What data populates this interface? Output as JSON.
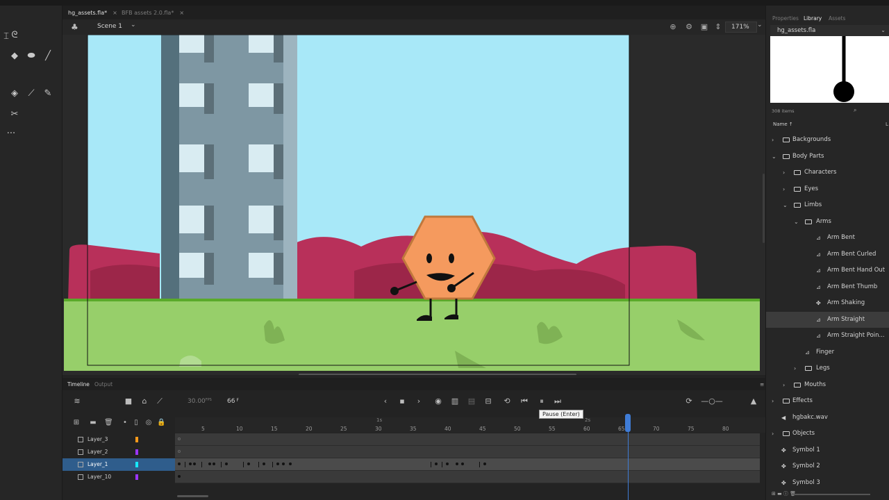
{
  "tabs": [
    {
      "label": "hg_assets.fla*",
      "active": true
    },
    {
      "label": "BFB assets 2.0.fla*",
      "active": false
    }
  ],
  "scene": {
    "label": "Scene 1",
    "zoom": "171%"
  },
  "timeline": {
    "tabs": [
      "Timeline",
      "Output"
    ],
    "fps": "30.00",
    "fps_unit": "FPS",
    "frame": "66",
    "frame_unit": "F",
    "tooltip": "Pause (Enter)",
    "seconds_markers": [
      "1s",
      "2s"
    ],
    "ruler_ticks": [
      "5",
      "10",
      "15",
      "20",
      "25",
      "30",
      "35",
      "40",
      "45",
      "50",
      "55",
      "60",
      "65",
      "70",
      "75",
      "80"
    ],
    "layers": [
      {
        "name": "Layer_3",
        "color": "#ff9a1a",
        "active": false
      },
      {
        "name": "Layer_2",
        "color": "#9b35ff",
        "active": false
      },
      {
        "name": "Layer_1",
        "color": "#17e8ff",
        "active": true
      },
      {
        "name": "Layer_10",
        "color": "#9b35ff",
        "active": false
      }
    ]
  },
  "library": {
    "tabs": [
      "Properties",
      "Library",
      "Assets"
    ],
    "active_tab": "Library",
    "document": "hg_assets.fla",
    "items_count": "308 items",
    "name_column": "Name",
    "tree": [
      {
        "label": "Backgrounds",
        "type": "folder",
        "depth": 0,
        "expanded": false
      },
      {
        "label": "Body Parts",
        "type": "folder",
        "depth": 0,
        "expanded": true
      },
      {
        "label": "Characters",
        "type": "folder",
        "depth": 1,
        "expanded": false
      },
      {
        "label": "Eyes",
        "type": "folder",
        "depth": 1,
        "expanded": false
      },
      {
        "label": "Limbs",
        "type": "folder",
        "depth": 1,
        "expanded": true
      },
      {
        "label": "Arms",
        "type": "folder",
        "depth": 2,
        "expanded": true
      },
      {
        "label": "Arm Bent",
        "type": "graphic",
        "depth": 3
      },
      {
        "label": "Arm Bent Curled",
        "type": "graphic",
        "depth": 3
      },
      {
        "label": "Arm Bent Hand Out",
        "type": "graphic",
        "depth": 3
      },
      {
        "label": "Arm Bent Thumb",
        "type": "graphic",
        "depth": 3
      },
      {
        "label": "Arm Shaking",
        "type": "symbol",
        "depth": 3
      },
      {
        "label": "Arm Straight",
        "type": "graphic",
        "depth": 3,
        "selected": true
      },
      {
        "label": "Arm Straight Poin...",
        "type": "graphic",
        "depth": 3
      },
      {
        "label": "Finger",
        "type": "graphic",
        "depth": 2
      },
      {
        "label": "Legs",
        "type": "folder",
        "depth": 2,
        "expanded": false
      },
      {
        "label": "Mouths",
        "type": "folder",
        "depth": 1,
        "expanded": false
      },
      {
        "label": "Effects",
        "type": "folder",
        "depth": 0,
        "expanded": false
      },
      {
        "label": "hgbakc.wav",
        "type": "sound",
        "depth": 0
      },
      {
        "label": "Objects",
        "type": "folder",
        "depth": 0,
        "expanded": false
      },
      {
        "label": "Symbol 1",
        "type": "symbol",
        "depth": 0
      },
      {
        "label": "Symbol 2",
        "type": "symbol",
        "depth": 0
      },
      {
        "label": "Symbol 3",
        "type": "symbol",
        "depth": 0
      }
    ]
  },
  "colors": {
    "sky": "#a8e8f8",
    "building": "#7e97a3",
    "bushes": "#b8305a",
    "grass": "#97cf6a",
    "hexagon": "#f59a5e",
    "selection": "#2f5d8c",
    "playhead": "#3f7cd6"
  }
}
